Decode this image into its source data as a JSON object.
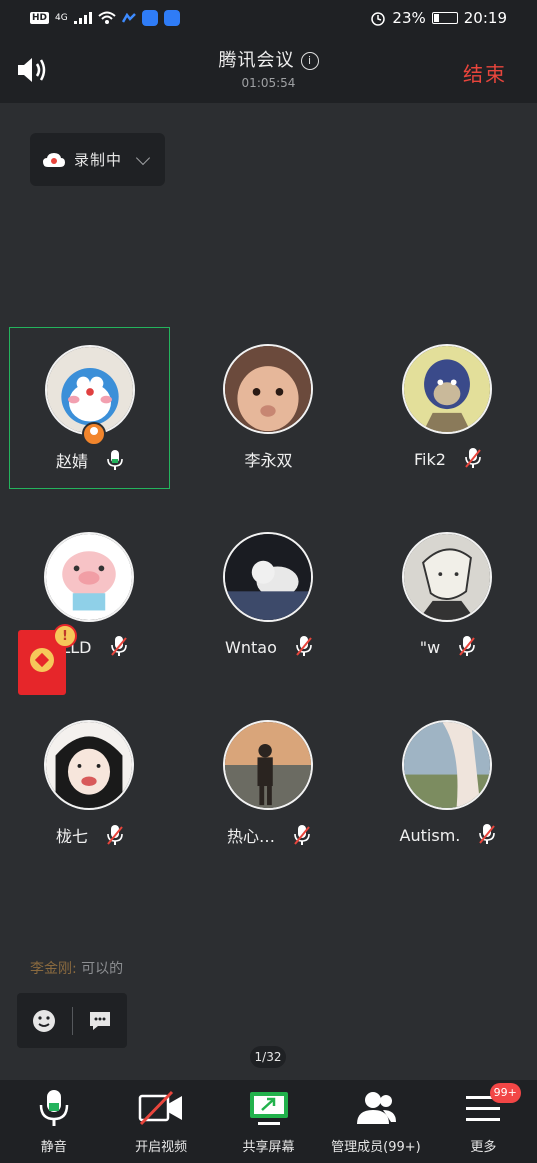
{
  "status_bar": {
    "hd_label": "HD",
    "signal_label": "4G",
    "battery": "23%",
    "time": "20:19",
    "battery_level": 0.23
  },
  "header": {
    "title": "腾讯会议",
    "timer": "01:05:54",
    "end_label": "结束"
  },
  "recording": {
    "label": "录制中"
  },
  "participants": [
    {
      "name": "赵婧",
      "mic": "on",
      "host": true,
      "active": true,
      "avatar": "doraemon-avatar"
    },
    {
      "name": "李永双",
      "mic": "on",
      "host": false,
      "active": false,
      "avatar": "baby-avatar"
    },
    {
      "name": "Fik2",
      "mic": "muted",
      "host": false,
      "active": false,
      "avatar": "ape-avatar"
    },
    {
      "name": "LLLD",
      "mic": "muted",
      "host": false,
      "active": false,
      "avatar": "pig-avatar"
    },
    {
      "name": "Wntao",
      "mic": "muted",
      "host": false,
      "active": false,
      "avatar": "cat-avatar"
    },
    {
      "name": "\"w",
      "mic": "muted",
      "host": false,
      "active": false,
      "avatar": "anime-avatar"
    },
    {
      "name": "栊七",
      "mic": "muted",
      "host": false,
      "active": false,
      "avatar": "girl-avatar"
    },
    {
      "name": "热心…",
      "mic": "muted",
      "host": false,
      "active": false,
      "avatar": "person-avatar"
    },
    {
      "name": "Autism.",
      "mic": "muted",
      "host": false,
      "active": false,
      "avatar": "cloth-avatar"
    }
  ],
  "red_packet": {
    "badge": "!"
  },
  "chat": {
    "sender": "李金刚:",
    "message": " 可以的"
  },
  "page_indicator": "1/32",
  "toolbar": {
    "items": [
      {
        "label": "静音",
        "icon": "mic-icon"
      },
      {
        "label": "开启视频",
        "icon": "video-off-icon"
      },
      {
        "label": "共享屏幕",
        "icon": "share-screen-icon"
      },
      {
        "label": "管理成员(99+)",
        "icon": "members-icon"
      },
      {
        "label": "更多",
        "icon": "menu-icon"
      }
    ],
    "more_badge": "99+"
  },
  "colors": {
    "background": "#2c2e31",
    "bar": "#1f2124",
    "end_red": "#e8453c",
    "active_green": "#24b35d",
    "muted_red": "#e8453c",
    "share_green": "#22b24c"
  }
}
